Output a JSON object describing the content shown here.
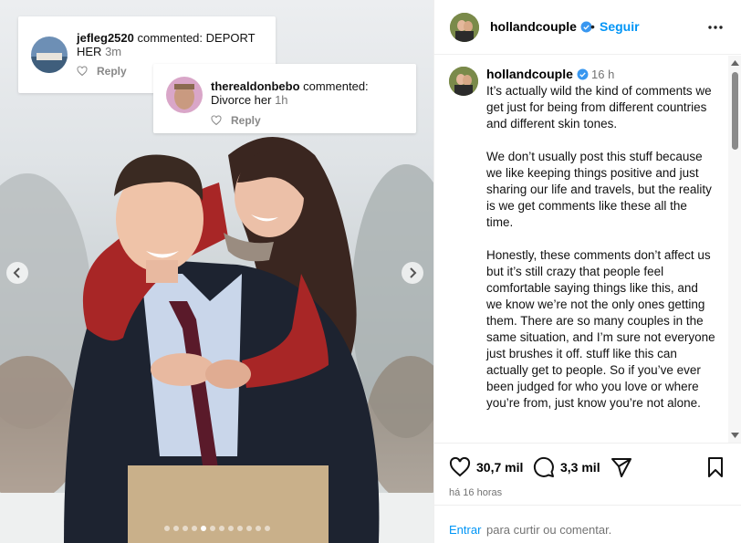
{
  "post": {
    "username": "hollandcouple",
    "follow_label": "Seguir",
    "separator": "•",
    "caption_time": "16 h",
    "caption": "It’s actually wild the kind of comments we get just for being from different countries and different skin tones.\n\nWe don’t usually post this stuff because we like keeping things positive and just sharing our life and travels, but the reality is we get comments like these all the time.\n\nHonestly, these comments don’t affect us but it’s still crazy that people feel comfortable saying things like this, and we know we’re not the only ones getting them. There are so many couples in the same situation, and I’m sure not everyone just brushes it off. stuff like this can actually get to people. So if you’ve ever been judged for who you love or where you’re from, just know you’re not alone.",
    "likes": "30,7 mil",
    "comments": "3,3 mil",
    "posted_ago": "há 16 horas",
    "comment_prompt_link": "Entrar",
    "comment_prompt_rest": "para curtir ou comentar."
  },
  "overlay_comments": [
    {
      "username": "jefleg2520",
      "action": " commented: DEPORT HER ",
      "time": "3m",
      "reply_label": "Reply"
    },
    {
      "username": "therealdonbebo",
      "action": " commented: Divorce her ",
      "time": "1h",
      "reply_label": "Reply"
    }
  ],
  "carousel": {
    "slide_count": 12,
    "active_index": 4
  },
  "icons": [
    "verified-badge-icon",
    "more-options-icon",
    "heart-icon",
    "comment-bubble-icon",
    "share-icon",
    "bookmark-icon",
    "chevron-left-icon",
    "chevron-right-icon"
  ],
  "colors": {
    "accent": "#0095f6",
    "verified": "#3897f0",
    "text": "#000000",
    "muted": "#737373"
  }
}
